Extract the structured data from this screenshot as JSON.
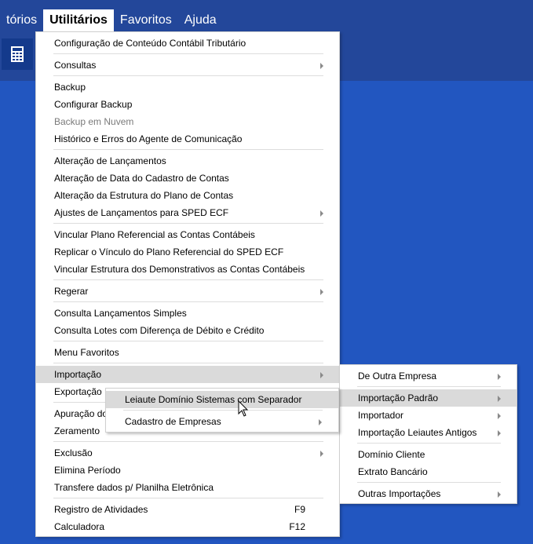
{
  "menubar": {
    "items": [
      {
        "label": "tórios"
      },
      {
        "label": "Utilitários",
        "selected": true
      },
      {
        "label": "Favoritos"
      },
      {
        "label": "Ajuda"
      }
    ]
  },
  "toolbar": {
    "calculator_icon": "calculator-icon"
  },
  "main_menu": [
    {
      "label": "Configuração de Conteúdo Contábil Tributário"
    },
    {
      "sep": true
    },
    {
      "label": "Consultas",
      "submenu": true
    },
    {
      "sep": true
    },
    {
      "label": "Backup"
    },
    {
      "label": "Configurar Backup"
    },
    {
      "label": "Backup em Nuvem",
      "disabled": true
    },
    {
      "label": "Histórico e Erros do Agente de Comunicação"
    },
    {
      "sep": true
    },
    {
      "label": "Alteração de Lançamentos"
    },
    {
      "label": "Alteração de Data do Cadastro de Contas"
    },
    {
      "label": "Alteração da Estrutura do Plano de Contas"
    },
    {
      "label": "Ajustes de Lançamentos para SPED ECF",
      "submenu": true
    },
    {
      "sep": true
    },
    {
      "label": "Vincular Plano Referencial as Contas Contábeis"
    },
    {
      "label": "Replicar o Vínculo do Plano Referencial do SPED ECF"
    },
    {
      "label": "Vincular Estrutura dos Demonstrativos as Contas Contábeis"
    },
    {
      "sep": true
    },
    {
      "label": "Regerar",
      "submenu": true
    },
    {
      "sep": true
    },
    {
      "label": "Consulta Lançamentos Simples"
    },
    {
      "label": "Consulta Lotes com Diferença de Débito e Crédito"
    },
    {
      "sep": true
    },
    {
      "label": "Menu Favoritos"
    },
    {
      "sep": true
    },
    {
      "label": "Importação",
      "submenu": true,
      "highlighted": true
    },
    {
      "label": "Exportação"
    },
    {
      "sep": true
    },
    {
      "label": "Apuração do"
    },
    {
      "label": "Zeramento"
    },
    {
      "sep": true
    },
    {
      "label": "Exclusão",
      "submenu": true
    },
    {
      "label": "Elimina Período"
    },
    {
      "label": "Transfere dados p/ Planilha Eletrônica"
    },
    {
      "sep": true
    },
    {
      "label": "Registro de Atividades",
      "shortcut": "F9"
    },
    {
      "label": "Calculadora",
      "shortcut": "F12"
    }
  ],
  "importacao_submenu": [
    {
      "label": "De Outra Empresa",
      "submenu": true
    },
    {
      "sep": true
    },
    {
      "label": "Importação Padrão",
      "submenu": true,
      "highlighted": true
    },
    {
      "label": "Importador",
      "submenu": true
    },
    {
      "label": "Importação Leiautes Antigos",
      "submenu": true
    },
    {
      "sep": true
    },
    {
      "label": "Domínio Cliente"
    },
    {
      "label": "Extrato Bancário"
    },
    {
      "sep": true
    },
    {
      "label": "Outras Importações",
      "submenu": true
    }
  ],
  "importacao_padrao_submenu": [
    {
      "label": "Leiaute Domínio Sistemas com Separador",
      "highlighted": true
    },
    {
      "sep": true
    },
    {
      "label": "Cadastro de Empresas",
      "submenu": true
    }
  ]
}
